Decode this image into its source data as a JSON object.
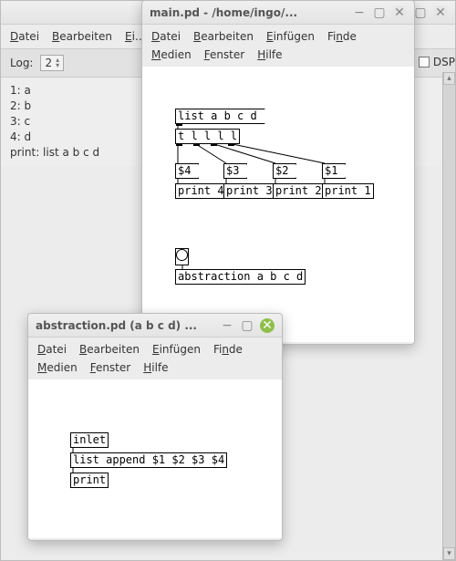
{
  "bg_window": {
    "title": "",
    "menu": [
      "Datei",
      "Bearbeiten",
      "Einfügen"
    ],
    "log_label": "Log:",
    "log_value": "2",
    "console_lines": [
      "1: a",
      "2: b",
      "3: c",
      "4: d",
      "print: list a b c d"
    ],
    "dsp_label": "DSP"
  },
  "main_window": {
    "title": "main.pd  - /home/ingo/...",
    "menu1": [
      "Datei",
      "Bearbeiten",
      "Einfügen",
      "Finde"
    ],
    "menu2": [
      "Medien",
      "Fenster",
      "Hilfe"
    ],
    "objects": {
      "msg_list": "list a b c d",
      "trigger": "t l l l l",
      "d4": "$4",
      "d3": "$3",
      "d2": "$2",
      "d1": "$1",
      "p4": "print 4",
      "p3": "print 3",
      "p2": "print 2",
      "p1": "print 1",
      "abstraction": "abstraction a b c d"
    }
  },
  "abs_window": {
    "title": "abstraction.pd (a b c d) ...",
    "menu1": [
      "Datei",
      "Bearbeiten",
      "Einfügen",
      "Finde"
    ],
    "menu2": [
      "Medien",
      "Fenster",
      "Hilfe"
    ],
    "objects": {
      "inlet": "inlet",
      "list_append": "list append $1 $2 $3 $4",
      "print": "print"
    }
  }
}
